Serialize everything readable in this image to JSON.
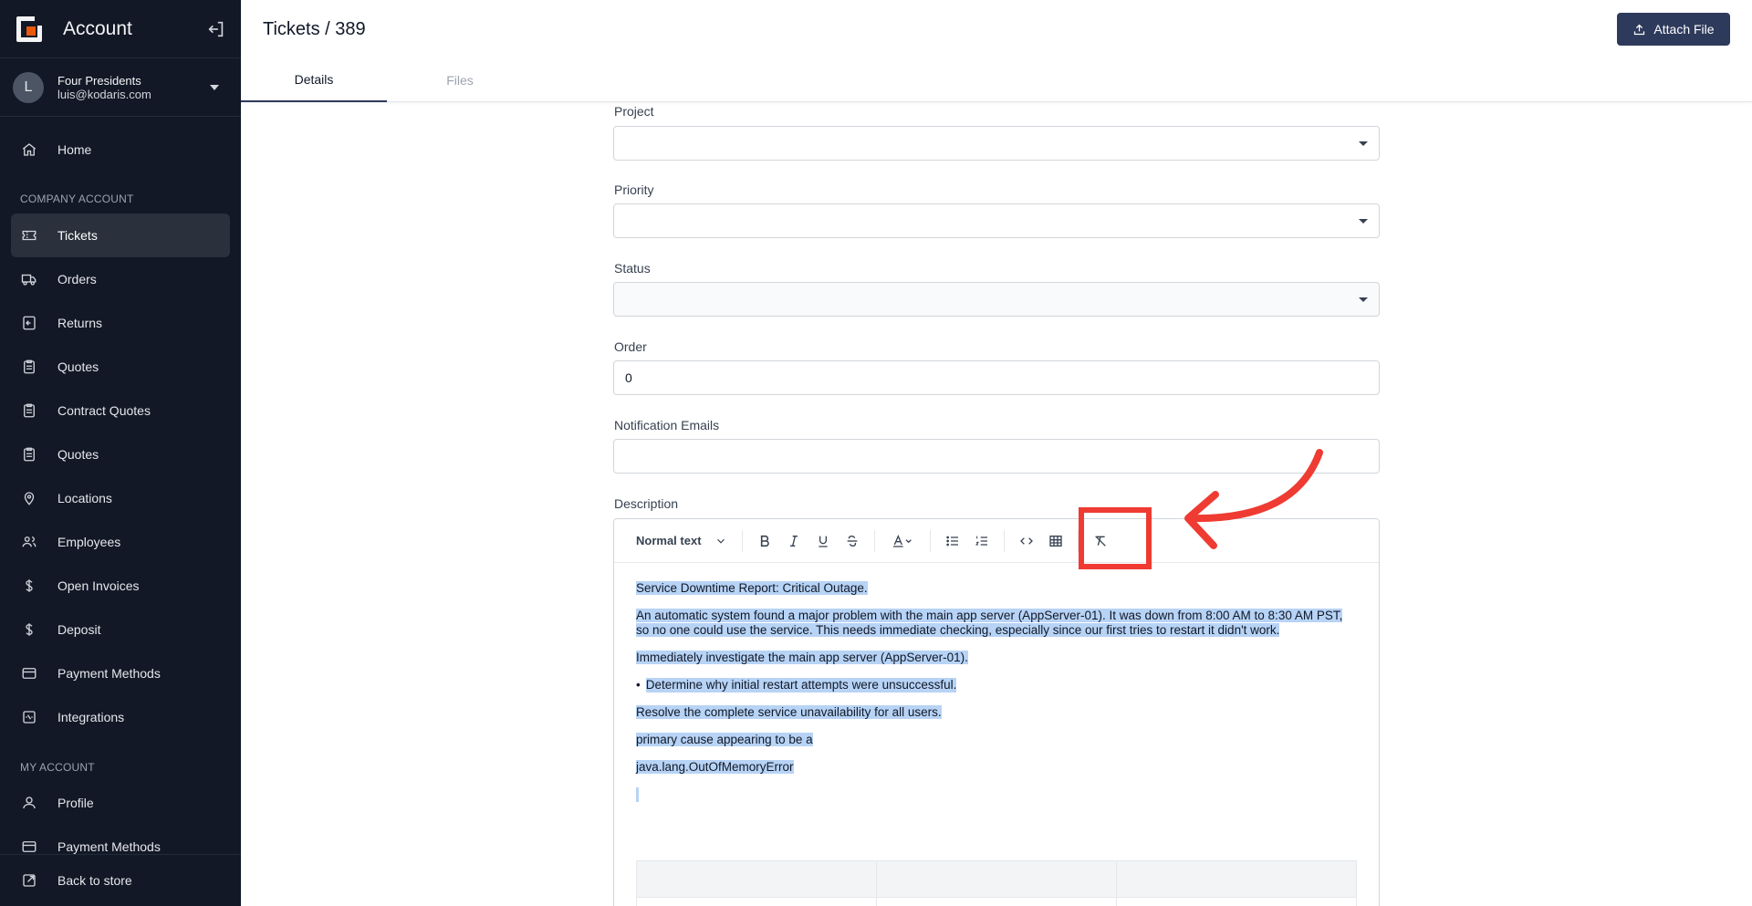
{
  "sidebar": {
    "title": "Account",
    "user": {
      "initial": "L",
      "name": "Four Presidents",
      "email": "luis@kodaris.com"
    },
    "home": "Home",
    "section_company": "COMPANY ACCOUNT",
    "items": [
      {
        "label": "Tickets",
        "icon": "ticket-icon",
        "active": true
      },
      {
        "label": "Orders",
        "icon": "truck-icon"
      },
      {
        "label": "Returns",
        "icon": "return-icon"
      },
      {
        "label": "Quotes",
        "icon": "clipboard-icon"
      },
      {
        "label": "Contract Quotes",
        "icon": "clipboard-icon"
      },
      {
        "label": "Quotes",
        "icon": "clipboard-icon"
      },
      {
        "label": "Locations",
        "icon": "pin-icon"
      },
      {
        "label": "Employees",
        "icon": "users-icon"
      },
      {
        "label": "Open Invoices",
        "icon": "dollar-icon"
      },
      {
        "label": "Deposit",
        "icon": "dollar-icon"
      },
      {
        "label": "Payment Methods",
        "icon": "card-icon"
      },
      {
        "label": "Integrations",
        "icon": "integration-icon"
      }
    ],
    "section_my": "MY ACCOUNT",
    "my_items": [
      {
        "label": "Profile",
        "icon": "user-icon"
      },
      {
        "label": "Payment Methods",
        "icon": "card-icon"
      }
    ],
    "back": "Back to store"
  },
  "header": {
    "breadcrumb": "Tickets / 389",
    "attach_label": "Attach File",
    "tabs": [
      "Details",
      "Files"
    ],
    "active_tab": "Details"
  },
  "form": {
    "project_label": "Project",
    "project_value": "",
    "priority_label": "Priority",
    "priority_value": "",
    "status_label": "Status",
    "status_value": "",
    "order_label": "Order",
    "order_value": "0",
    "emails_label": "Notification Emails",
    "emails_value": "",
    "description_label": "Description"
  },
  "editor": {
    "format": "Normal text",
    "toolbar_icons": [
      "bold-icon",
      "italic-icon",
      "underline-icon",
      "strikethrough-icon",
      "text-color-icon",
      "bullet-list-icon",
      "numbered-list-icon",
      "code-icon",
      "table-icon",
      "clear-formatting-icon"
    ],
    "p1": "Service Downtime Report: Critical Outage.",
    "p2": "An automatic system found a major problem with the main app server (AppServer-01). It was down from 8:00 AM to 8:30 AM PST, so no one could use the service. This needs immediate checking, especially since our first tries to restart it didn't work.",
    "p3": "Immediately investigate the main app server (AppServer-01).",
    "bullet1": "Determine why initial restart attempts were unsuccessful.",
    "p4": "Resolve the complete service unavailability for all users.",
    "p5": "primary cause appearing to be a",
    "p6": "java.lang.OutOfMemoryError",
    "selection_color": "#b7d3f5"
  },
  "annotation": {
    "color": "#ef3b32",
    "target": "clear-formatting-icon"
  }
}
